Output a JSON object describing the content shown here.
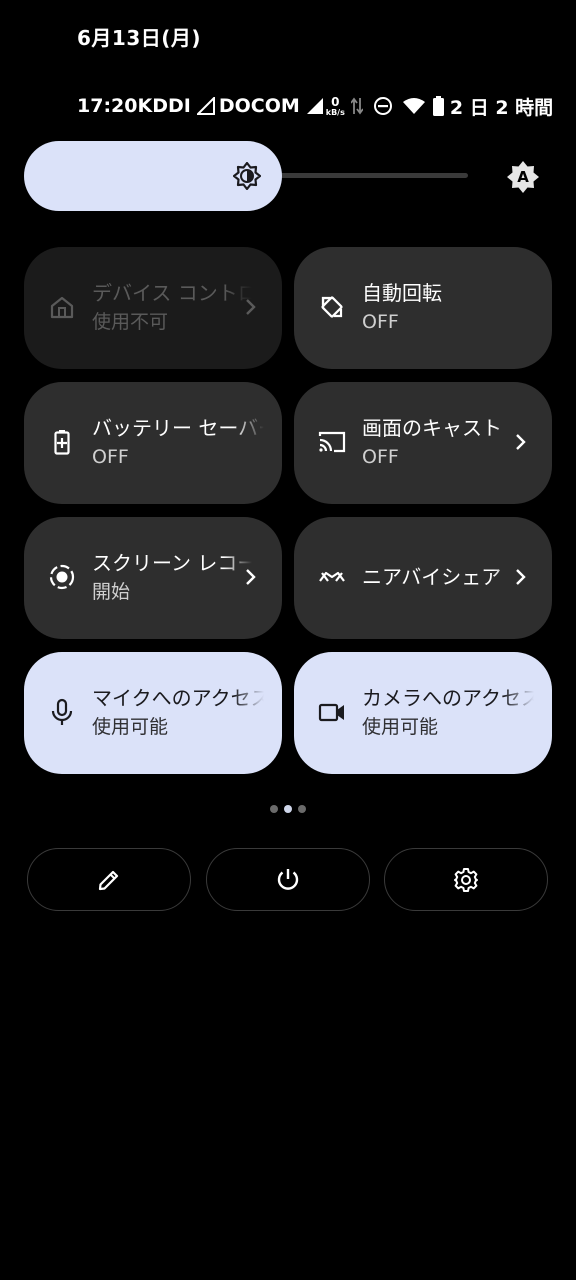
{
  "date": "6月13日(月)",
  "status_bar": {
    "time": "17:20",
    "carrier1": "KDDI",
    "carrier2": "DOCOM",
    "data_rate_value": "0",
    "data_rate_unit": "kB/s",
    "alarm": "2 日 2 時間"
  },
  "brightness": {
    "level": 0.5,
    "auto_label": "A"
  },
  "tiles": [
    {
      "title": "デバイス コントロール",
      "subtitle": "使用不可",
      "icon": "home-icon",
      "state": "disabled",
      "chevron": true
    },
    {
      "title": "自動回転",
      "subtitle": "OFF",
      "icon": "rotate-icon",
      "state": "off",
      "chevron": false
    },
    {
      "title": "バッテリー セーバー",
      "subtitle": "OFF",
      "icon": "battery-saver-icon",
      "state": "off",
      "chevron": false
    },
    {
      "title": "画面のキャスト",
      "subtitle": "OFF",
      "icon": "cast-icon",
      "state": "off",
      "chevron": true
    },
    {
      "title": "スクリーン レコード",
      "subtitle": "開始",
      "icon": "screen-record-icon",
      "state": "off",
      "chevron": true
    },
    {
      "title": "ニアバイシェア",
      "subtitle": "",
      "icon": "nearby-share-icon",
      "state": "off",
      "chevron": true
    },
    {
      "title": "マイクへのアクセス",
      "subtitle": "使用可能",
      "icon": "mic-icon",
      "state": "on",
      "chevron": false
    },
    {
      "title": "カメラへのアクセス",
      "subtitle": "使用可能",
      "icon": "camera-icon",
      "state": "on",
      "chevron": false
    }
  ],
  "pager": {
    "pages": 3,
    "current": 2
  },
  "bottom_buttons": [
    {
      "icon": "edit-icon"
    },
    {
      "icon": "power-icon"
    },
    {
      "icon": "settings-icon"
    }
  ]
}
